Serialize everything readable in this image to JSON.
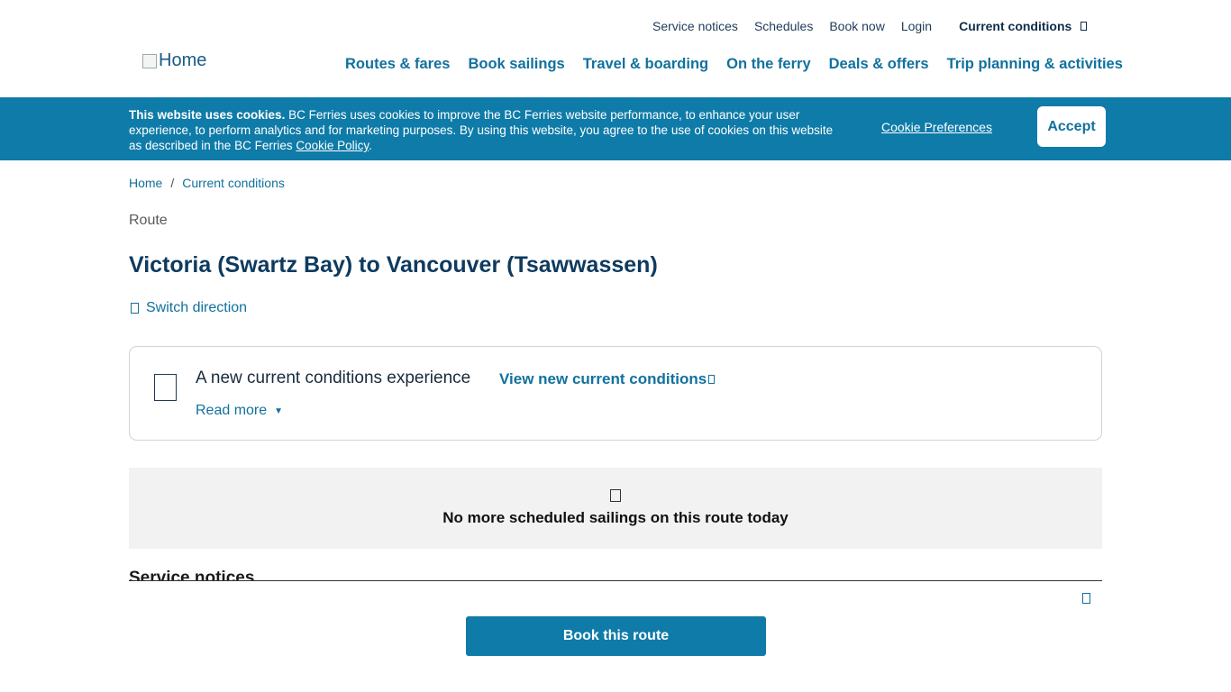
{
  "header": {
    "logo_alt": "Home",
    "utility_nav": [
      "Service notices",
      "Schedules",
      "Book now",
      "Login"
    ],
    "current_conditions": "Current conditions",
    "main_nav": [
      "Routes & fares",
      "Book sailings",
      "Travel & boarding",
      "On the ferry",
      "Deals & offers",
      "Trip planning & activities"
    ]
  },
  "cookie_banner": {
    "bold": "This website uses cookies.",
    "text": " BC Ferries uses cookies to improve the BC Ferries website performance, to enhance your user experience, to perform analytics and for marketing purposes. By using this website, you agree to the use of cookies on this website as described in the BC Ferries ",
    "policy_link": "Cookie Policy",
    "end": ".",
    "preferences": "Cookie Preferences",
    "accept": "Accept",
    "color": "#0f7ba8"
  },
  "breadcrumb": {
    "home": "Home",
    "separator": "/",
    "current": "Current conditions"
  },
  "page": {
    "route_label": "Route",
    "title": "Victoria (Swartz Bay) to Vancouver (Tsawwassen)",
    "switch_direction": "Switch direction"
  },
  "info_card": {
    "heading": "A new current conditions experience",
    "link": "View new current conditions",
    "read_more": "Read more",
    "caret": "▼"
  },
  "no_sailings": {
    "text": "No more scheduled sailings on this route today"
  },
  "service_notices": {
    "heading": "Service notices"
  },
  "sticky": {
    "book_button": "Book this route"
  }
}
